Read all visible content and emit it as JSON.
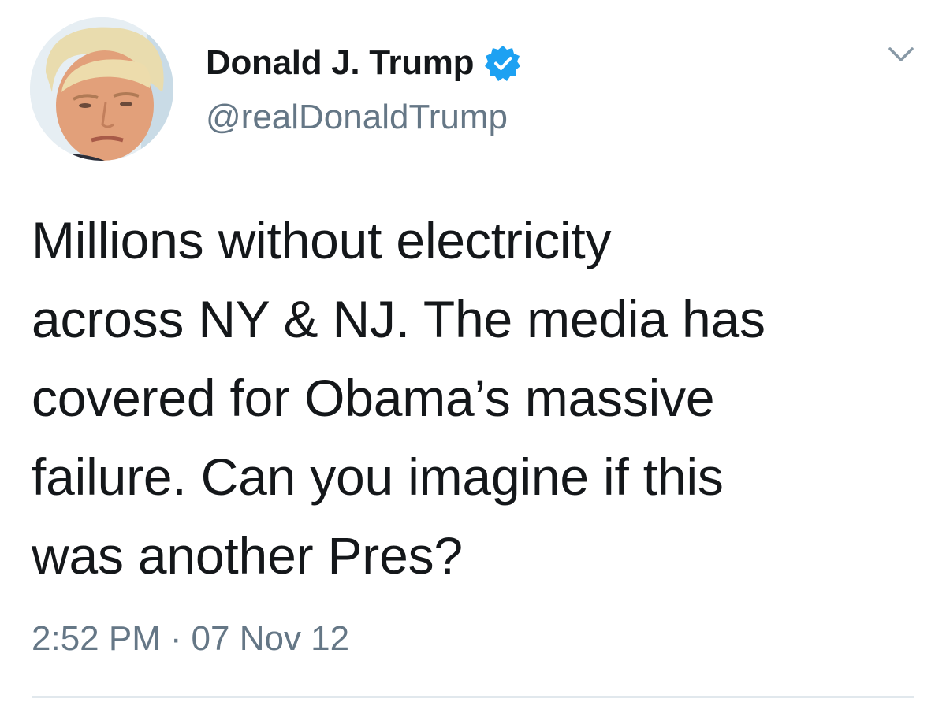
{
  "author": {
    "display_name": "Donald J. Trump",
    "handle": "@realDonaldTrump",
    "verified": true,
    "verified_color": "#1da1f2"
  },
  "tweet": {
    "lines": [
      "Millions without electricity",
      "across NY & NJ. The media has",
      "covered for Obama’s massive",
      "failure. Can you imagine if this",
      "was another Pres?"
    ]
  },
  "meta": {
    "time": "2:52 PM",
    "separator": "·",
    "date": "07 Nov 12"
  },
  "icons": {
    "verified": "verified-badge-icon",
    "menu": "chevron-down-icon"
  },
  "colors": {
    "text": "#14171a",
    "secondary": "#657786",
    "divider": "#e1e8ed"
  }
}
